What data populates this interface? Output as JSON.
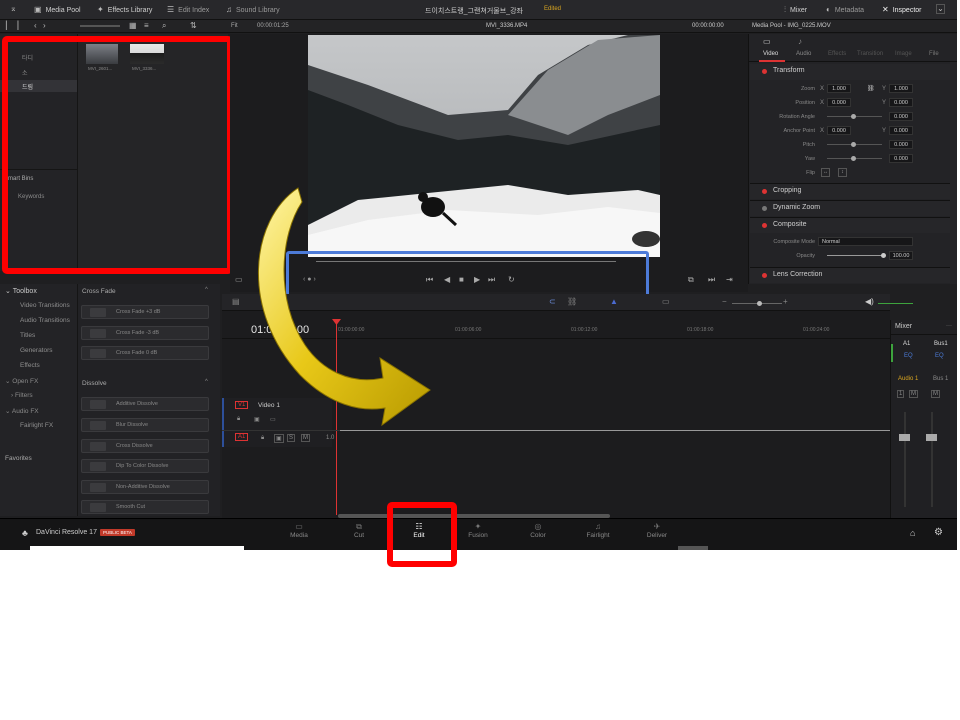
{
  "topbar": {
    "media_pool": "Media Pool",
    "effects_library": "Effects Library",
    "edit_index": "Edit Index",
    "sound_library": "Sound Library",
    "project_title": "드이치스트랭_그랜쳐거물브_강좌",
    "edited": "Edited",
    "mixer": "Mixer",
    "metadata": "Metadata",
    "inspector": "Inspector"
  },
  "viewer": {
    "fit": "Fit",
    "timecode_left": "00:00:01:25",
    "clip_name": "MVI_3336.MP4",
    "timecode_right": "00:00:00:00"
  },
  "media_pool": {
    "folders": [
      "타디",
      "소",
      "드림"
    ],
    "smart_bins": "Smart Bins",
    "keywords": "Keywords",
    "clips": [
      "MVI_2601...",
      "MVI_3336..."
    ]
  },
  "toolbox": {
    "header": "Toolbox",
    "items": [
      "Video Transitions",
      "Audio Transitions",
      "Titles",
      "Generators",
      "Effects"
    ],
    "openfx": "Open FX",
    "filters": "Filters",
    "audiofx": "Audio FX",
    "fairlight_fx": "Fairlight FX",
    "favorites": "Favorites"
  },
  "effects": {
    "crossfade_header": "Cross Fade",
    "crossfade_items": [
      "Cross Fade +3 dB",
      "Cross Fade -3 dB",
      "Cross Fade 0 dB"
    ],
    "dissolve_header": "Dissolve",
    "dissolve_items": [
      "Additive Dissolve",
      "Blur Dissolve",
      "Cross Dissolve",
      "Dip To Color Dissolve",
      "Non-Additive Dissolve",
      "Smooth Cut"
    ]
  },
  "inspector": {
    "title": "Media Pool - IMG_0225.MOV",
    "tabs": [
      "Video",
      "Audio",
      "Effects",
      "Transition",
      "Image",
      "File"
    ],
    "transform": "Transform",
    "zoom_label": "Zoom",
    "zoom_x": "1.000",
    "zoom_y": "1.000",
    "position_label": "Position",
    "position_x": "0.000",
    "position_y": "0.000",
    "rotation_label": "Rotation Angle",
    "rotation": "0.000",
    "anchor_label": "Anchor Point",
    "anchor_x": "0.000",
    "anchor_y": "0.000",
    "pitch_label": "Pitch",
    "pitch": "0.000",
    "yaw_label": "Yaw",
    "yaw": "0.000",
    "flip_label": "Flip",
    "cropping": "Cropping",
    "dynamic_zoom": "Dynamic Zoom",
    "composite": "Composite",
    "composite_mode_label": "Composite Mode",
    "composite_mode": "Normal",
    "opacity_label": "Opacity",
    "opacity": "100.00",
    "lens_correction": "Lens Correction"
  },
  "timeline": {
    "timecode": "01:00:00:00",
    "ticks": [
      "01:00:00:00",
      "01:00:06:00",
      "01:00:12:00",
      "01:00:18:00",
      "01:00:24:00"
    ],
    "video_track": "V1",
    "video_track_name": "Video 1",
    "audio_track": "A1",
    "audio_level": "1.0"
  },
  "mixer": {
    "title": "Mixer",
    "a1": "A1",
    "bus1": "Bus1",
    "audio1": "Audio 1",
    "bus1b": "Bus 1"
  },
  "pages": [
    "Media",
    "Cut",
    "Edit",
    "Fusion",
    "Color",
    "Fairlight",
    "Deliver"
  ],
  "app_name": "DaVinci Resolve 17",
  "beta": "PUBLIC BETA"
}
